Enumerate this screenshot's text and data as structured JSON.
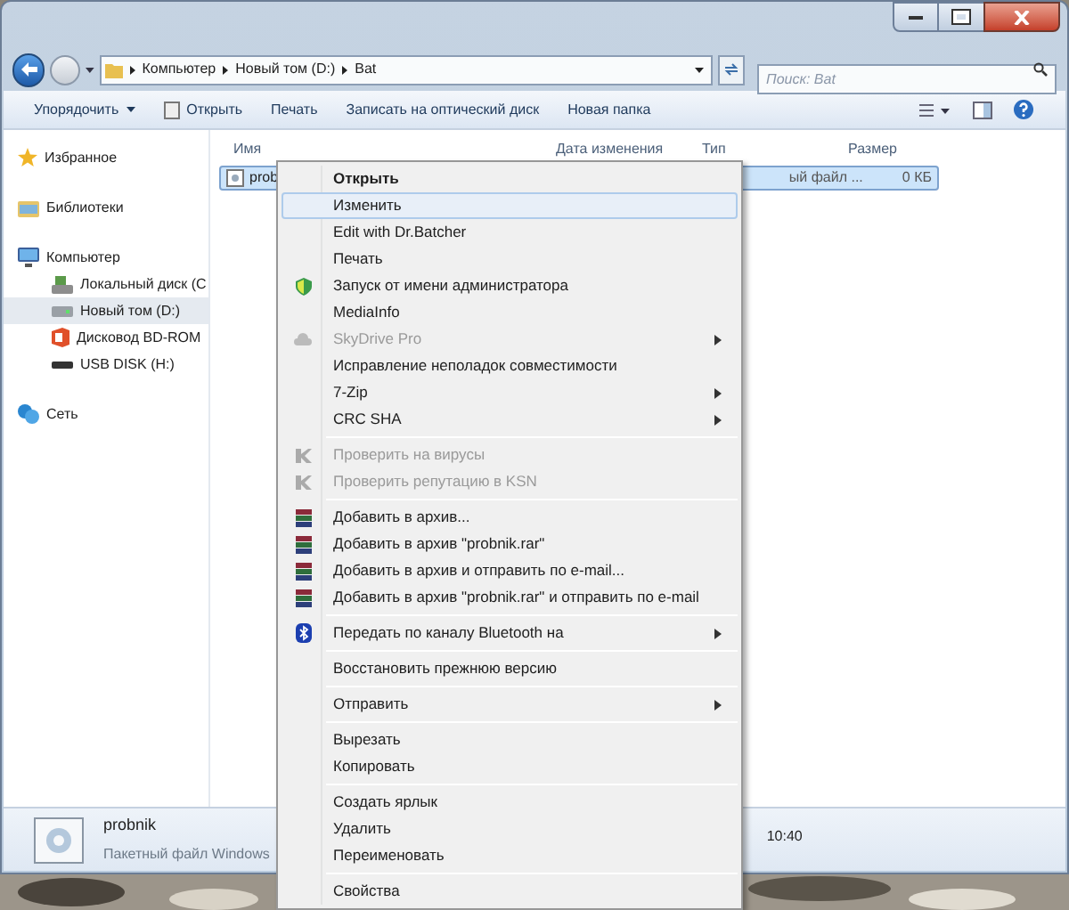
{
  "address_bar": {
    "crumbs": [
      "Компьютер",
      "Новый том (D:)",
      "Bat"
    ]
  },
  "search": {
    "placeholder": "Поиск: Bat"
  },
  "toolbar": {
    "buttons": [
      {
        "label": "Упорядочить",
        "kind": "dropdown"
      },
      {
        "label": "Открыть",
        "kind": "open"
      },
      {
        "label": "Печать",
        "kind": "plain"
      },
      {
        "label": "Записать на оптический диск",
        "kind": "plain"
      },
      {
        "label": "Новая папка",
        "kind": "plain"
      }
    ]
  },
  "sidebar": {
    "groups": [
      {
        "label": "Избранное",
        "kind": "star"
      },
      {
        "label": "Библиотеки",
        "kind": "library"
      },
      {
        "label": "Компьютер",
        "kind": "computer",
        "children": [
          {
            "label": "Локальный диск (С",
            "kind": "system-drive",
            "selected": false
          },
          {
            "label": "Новый том (D:)",
            "kind": "drive",
            "selected": true
          },
          {
            "label": "Дисковод BD-ROM",
            "kind": "optical",
            "selected": false
          },
          {
            "label": "USB DISK (H:)",
            "kind": "usb",
            "selected": false
          }
        ]
      },
      {
        "label": "Сеть",
        "kind": "network"
      }
    ]
  },
  "table": {
    "columns": [
      "Имя",
      "Дата изменения",
      "Тип",
      "Размер"
    ],
    "rows": [
      {
        "name": "prob",
        "type": "ый файл ...",
        "size": "0 КБ",
        "selected": true
      }
    ]
  },
  "context_menu": {
    "groups": [
      [
        {
          "label": "Открыть",
          "kind": "plain",
          "bold": true,
          "selected": false,
          "disabled": false,
          "submenu": false
        },
        {
          "label": "Изменить",
          "kind": "plain",
          "bold": false,
          "selected": true,
          "disabled": false,
          "submenu": false
        },
        {
          "label": "Edit with Dr.Batcher",
          "kind": "plain",
          "bold": false,
          "selected": false,
          "disabled": false,
          "submenu": false
        },
        {
          "label": "Печать",
          "kind": "plain",
          "bold": false,
          "selected": false,
          "disabled": false,
          "submenu": false
        },
        {
          "label": "Запуск от имени администратора",
          "kind": "admin",
          "bold": false,
          "selected": false,
          "disabled": false,
          "submenu": false
        },
        {
          "label": "MediaInfo",
          "kind": "plain",
          "bold": false,
          "selected": false,
          "disabled": false,
          "submenu": false
        },
        {
          "label": "SkyDrive Pro",
          "kind": "cloud",
          "bold": false,
          "selected": false,
          "disabled": true,
          "submenu": true
        },
        {
          "label": "Исправление неполадок совместимости",
          "kind": "plain",
          "bold": false,
          "selected": false,
          "disabled": false,
          "submenu": false
        },
        {
          "label": "7-Zip",
          "kind": "plain",
          "bold": false,
          "selected": false,
          "disabled": false,
          "submenu": true
        },
        {
          "label": "CRC SHA",
          "kind": "plain",
          "bold": false,
          "selected": false,
          "disabled": false,
          "submenu": true
        }
      ],
      [
        {
          "label": "Проверить на вирусы",
          "kind": "antivirus",
          "bold": false,
          "selected": false,
          "disabled": true,
          "submenu": false
        },
        {
          "label": "Проверить репутацию в KSN",
          "kind": "antivirus",
          "bold": false,
          "selected": false,
          "disabled": true,
          "submenu": false
        }
      ],
      [
        {
          "label": "Добавить в архив...",
          "kind": "archive",
          "bold": false,
          "selected": false,
          "disabled": false,
          "submenu": false
        },
        {
          "label": "Добавить в архив \"probnik.rar\"",
          "kind": "archive",
          "bold": false,
          "selected": false,
          "disabled": false,
          "submenu": false
        },
        {
          "label": "Добавить в архив и отправить по e-mail...",
          "kind": "archive",
          "bold": false,
          "selected": false,
          "disabled": false,
          "submenu": false
        },
        {
          "label": "Добавить в архив \"probnik.rar\" и отправить по e-mail",
          "kind": "archive",
          "bold": false,
          "selected": false,
          "disabled": false,
          "submenu": false
        }
      ],
      [
        {
          "label": "Передать по каналу Bluetooth на",
          "kind": "bluetooth",
          "bold": false,
          "selected": false,
          "disabled": false,
          "submenu": true
        }
      ],
      [
        {
          "label": "Восстановить прежнюю версию",
          "kind": "plain",
          "bold": false,
          "selected": false,
          "disabled": false,
          "submenu": false
        }
      ],
      [
        {
          "label": "Отправить",
          "kind": "plain",
          "bold": false,
          "selected": false,
          "disabled": false,
          "submenu": true
        }
      ],
      [
        {
          "label": "Вырезать",
          "kind": "plain",
          "bold": false,
          "selected": false,
          "disabled": false,
          "submenu": false
        },
        {
          "label": "Копировать",
          "kind": "plain",
          "bold": false,
          "selected": false,
          "disabled": false,
          "submenu": false
        }
      ],
      [
        {
          "label": "Создать ярлык",
          "kind": "plain",
          "bold": false,
          "selected": false,
          "disabled": false,
          "submenu": false
        },
        {
          "label": "Удалить",
          "kind": "plain",
          "bold": false,
          "selected": false,
          "disabled": false,
          "submenu": false
        },
        {
          "label": "Переименовать",
          "kind": "plain",
          "bold": false,
          "selected": false,
          "disabled": false,
          "submenu": false
        }
      ],
      [
        {
          "label": "Свойства",
          "kind": "plain",
          "bold": false,
          "selected": false,
          "disabled": false,
          "submenu": false
        }
      ]
    ]
  },
  "details": {
    "name": "probnik",
    "type": "Пакетный файл Windows",
    "time": "10:40"
  }
}
